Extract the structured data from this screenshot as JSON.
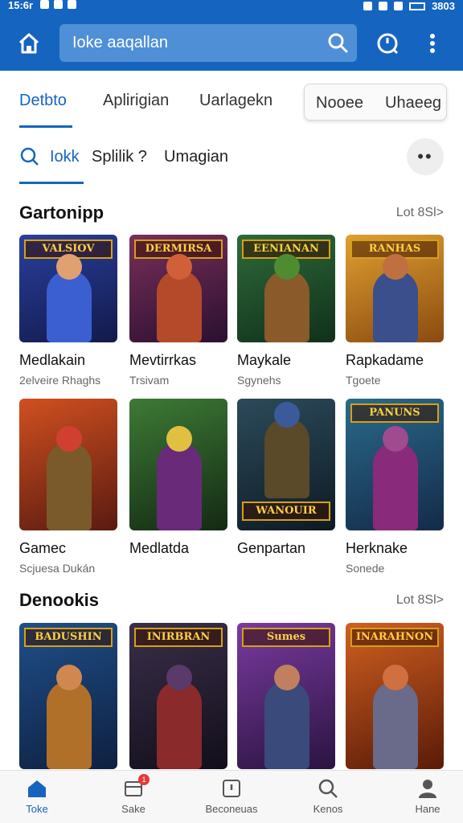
{
  "status": {
    "time": "15:6r",
    "right_text": "3803"
  },
  "header": {
    "search_placeholder": "Ioke aaqallan"
  },
  "tabs": [
    {
      "label": "Detbto",
      "active": true
    },
    {
      "label": "Aplirigian",
      "active": false
    },
    {
      "label": "Uarlagekn",
      "active": false
    },
    {
      "label": "Nooee",
      "active": false
    },
    {
      "label": "Uhaeeg",
      "active": false
    }
  ],
  "subtabs": [
    {
      "label": "Iokk",
      "active": true
    },
    {
      "label": "Splilik ?",
      "active": false
    },
    {
      "label": "Umagian",
      "active": false
    }
  ],
  "section1": {
    "title": "Gartonipp",
    "more": "Lot 8Sl>",
    "cards": [
      {
        "banner": "VALSIOV",
        "title": "Medlakain",
        "subtitle": "2elveire Rhaghs",
        "bg": "#2a3f9e",
        "hero": "#3b5fd1"
      },
      {
        "banner": "DERMIRSA",
        "title": "Mevtirrkas",
        "subtitle": "Trsivam",
        "bg": "#7a2f5a",
        "hero": "#b44a2a"
      },
      {
        "banner": "EENIANAN",
        "title": "Maykale",
        "subtitle": "Sgynehs",
        "bg": "#2f6a3a",
        "hero": "#4f8c2f"
      },
      {
        "banner": "RANHAS",
        "title": "Rapkadame",
        "subtitle": "Tgoete",
        "bg": "#b0661c",
        "hero": "#3a4f8c"
      }
    ]
  },
  "section2": {
    "cards": [
      {
        "banner": "",
        "title": "Gamec",
        "subtitle": "Scjuesa Dukán",
        "bg": "#b2451c",
        "hero": "#7a5a2a"
      },
      {
        "banner": "",
        "title": "Medlatda",
        "subtitle": "",
        "bg": "#3d7a35",
        "hero": "#6a2a7a"
      },
      {
        "banner": "WANOUIR",
        "title": "Genpartan",
        "subtitle": "",
        "bg": "#2c4a5a",
        "hero": "#5a4a2a"
      },
      {
        "banner": "PANUNS",
        "title": "Herknake",
        "subtitle": "Sonede",
        "bg": "#2a6a8a",
        "hero": "#8a2a7a"
      }
    ]
  },
  "section3": {
    "title": "Denookis",
    "more": "Lot 8Sl>",
    "cards": [
      {
        "banner": "BADUSHIN",
        "bg": "#1f4f8a",
        "hero": "#b0702a"
      },
      {
        "banner": "INIRBRAN",
        "bg": "#3a2f4a",
        "hero": "#8a2a2a"
      },
      {
        "banner": "Sumes",
        "bg": "#7a3aa0",
        "hero": "#3a4a7a"
      },
      {
        "banner": "INARAHNON",
        "bg": "#a8451c",
        "hero": "#6a6a8a"
      }
    ]
  },
  "bottom_nav": [
    {
      "label": "Toke",
      "icon": "home-icon",
      "active": true
    },
    {
      "label": "Sake",
      "icon": "inbox-icon",
      "active": false,
      "badge": "1"
    },
    {
      "label": "Beconeuas",
      "icon": "info-icon",
      "active": false
    },
    {
      "label": "Kenos",
      "icon": "search-icon",
      "active": false
    },
    {
      "label": "Hane",
      "icon": "profile-icon",
      "active": false
    }
  ],
  "colors": {
    "primary": "#1565c0",
    "search_bg": "#4f8fd6"
  }
}
